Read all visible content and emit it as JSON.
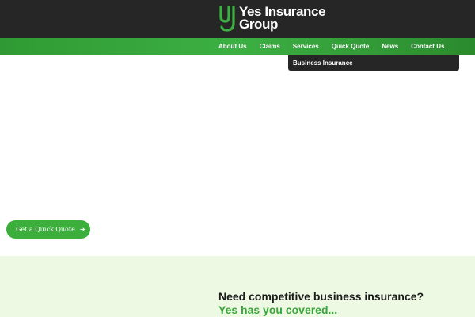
{
  "header": {
    "logo": {
      "line1": "Yes Insurance",
      "line2": "Group",
      "trademark": ".",
      "mark_icon": "yg-monogram-icon",
      "mark_color": "#3cb043"
    },
    "background": "#262626"
  },
  "nav": {
    "items": [
      {
        "label": "About Us"
      },
      {
        "label": "Claims"
      },
      {
        "label": "Services"
      },
      {
        "label": "Quick Quote"
      },
      {
        "label": "News"
      },
      {
        "label": "Contact Us"
      }
    ],
    "accent": "#3cb043"
  },
  "dropdown": {
    "items": [
      {
        "label": "Business Insurance"
      }
    ]
  },
  "hero": {
    "cta_label": "Get a Quick Quote",
    "cta_icon": "arrow-right-icon"
  },
  "section": {
    "headline": "Need competitive business insurance?",
    "subline": "Yes has you covered...",
    "background": "#eef9e4"
  }
}
